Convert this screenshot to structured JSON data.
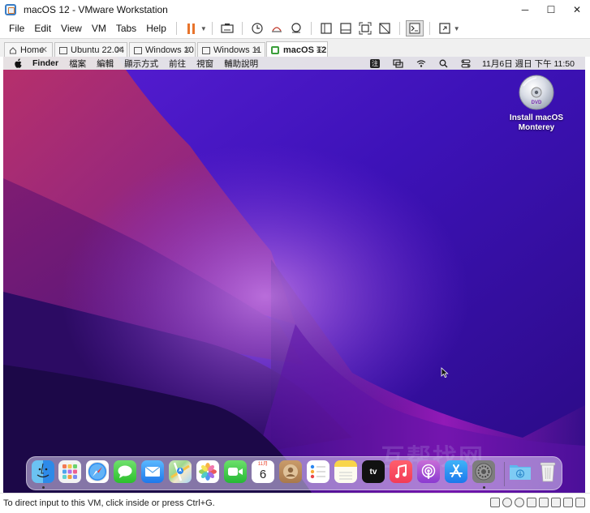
{
  "window": {
    "title": "macOS 12 - VMware Workstation",
    "minimize": "─",
    "maximize": "☐",
    "close": "✕"
  },
  "menu": [
    "File",
    "Edit",
    "View",
    "VM",
    "Tabs",
    "Help"
  ],
  "tabs": [
    {
      "label": "Home",
      "icon": "home-icon"
    },
    {
      "label": "Ubuntu 22.04",
      "icon": "vm-icon"
    },
    {
      "label": "Windows 10",
      "icon": "vm-icon"
    },
    {
      "label": "Windows 11",
      "icon": "vm-icon"
    },
    {
      "label": "macOS 12",
      "icon": "vm-icon",
      "active": true
    }
  ],
  "mac_menubar": {
    "app": "Finder",
    "items": [
      "檔案",
      "編輯",
      "顯示方式",
      "前往",
      "視窗",
      "輔助說明"
    ],
    "input_method": "注",
    "clock": "11月6日 週日 下午 11:50"
  },
  "desktop": {
    "dvd_label_line1": "Install macOS",
    "dvd_label_line2": "Monterey",
    "dvd_text": "DVD"
  },
  "dock": {
    "calendar_month": "11月",
    "calendar_day": "6",
    "tv_label": "tv",
    "apps": [
      "finder-icon",
      "launchpad-icon",
      "safari-icon",
      "messages-icon",
      "mail-icon",
      "maps-icon",
      "photos-icon",
      "facetime-icon",
      "calendar-icon",
      "contacts-icon",
      "reminders-icon",
      "notes-icon",
      "tv-icon",
      "music-icon",
      "podcasts-icon",
      "app-store-icon",
      "system-preferences-icon",
      "downloads-folder-icon",
      "trash-icon"
    ]
  },
  "watermark": "互帮找网",
  "statusbar": {
    "message": "To direct input to this VM, click inside or press Ctrl+G."
  },
  "colors": {
    "accent_orange": "#e8742c",
    "vmware_blue": "#3b7dc4",
    "wallpaper_deep": "#2a0a7a"
  }
}
